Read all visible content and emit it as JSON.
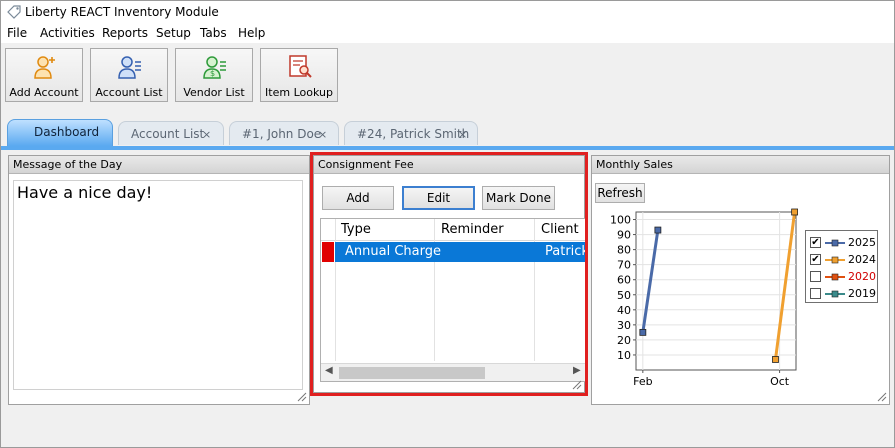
{
  "app": {
    "title": "Liberty REACT Inventory Module"
  },
  "menu": [
    "File",
    "Activities",
    "Reports",
    "Setup",
    "Tabs",
    "Help"
  ],
  "toolbar": [
    {
      "label": "Add Account",
      "icon": "add-account-icon"
    },
    {
      "label": "Account List",
      "icon": "account-list-icon"
    },
    {
      "label": "Vendor List",
      "icon": "vendor-list-icon"
    },
    {
      "label": "Item Lookup",
      "icon": "item-lookup-icon"
    }
  ],
  "tabs": [
    {
      "label": "Dashboard",
      "active": true,
      "closable": false
    },
    {
      "label": "Account List",
      "closable": true
    },
    {
      "label": "#1, John Doe",
      "closable": true
    },
    {
      "label": "#24, Patrick Smith",
      "closable": true
    }
  ],
  "close_glyph": "×",
  "motd": {
    "header": "Message of the Day",
    "text": "Have a nice day!"
  },
  "consignment": {
    "header": "Consignment Fee",
    "buttons": {
      "add": "Add",
      "edit": "Edit",
      "mark_done": "Mark Done"
    },
    "columns": [
      "Type",
      "Reminder",
      "Client"
    ],
    "rows": [
      {
        "type": "Annual Charge",
        "reminder": "",
        "client": "Patrick"
      }
    ]
  },
  "sales": {
    "header": "Monthly Sales",
    "refresh": "Refresh",
    "legend": [
      {
        "name": "2025",
        "checked": true,
        "color": "#4a6aa8",
        "label_color": "#000000"
      },
      {
        "name": "2024",
        "checked": true,
        "color": "#f0a030",
        "label_color": "#000000"
      },
      {
        "name": "2020",
        "checked": false,
        "color": "#e05010",
        "label_color": "#d00000"
      },
      {
        "name": "2019",
        "checked": false,
        "color": "#3a8a8a",
        "label_color": "#000000"
      }
    ]
  },
  "chart_data": {
    "type": "line",
    "x": [
      "Feb",
      "Oct"
    ],
    "xlabel": "",
    "ylabel": "",
    "ylim": [
      0,
      105
    ],
    "yticks": [
      10,
      20,
      30,
      40,
      50,
      60,
      70,
      80,
      90,
      100
    ],
    "grid": true,
    "legend_position": "right",
    "series": [
      {
        "name": "2025",
        "color": "#4a6aa8",
        "points": [
          [
            0,
            25
          ],
          [
            0.11,
            93
          ]
        ]
      },
      {
        "name": "2024",
        "color": "#f0a030",
        "points": [
          [
            0.97,
            7
          ],
          [
            1.11,
            106
          ]
        ]
      }
    ]
  },
  "checkmark": "✔"
}
